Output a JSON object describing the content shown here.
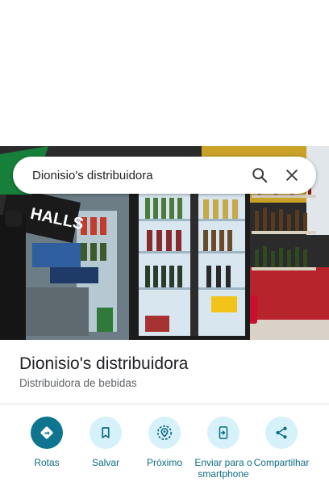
{
  "search": {
    "query": "Dionisio's distribuidora",
    "search_icon": "search-icon",
    "clear_icon": "close-icon"
  },
  "photo": {
    "ad_text": "HALLS"
  },
  "place": {
    "name": "Dionisio's distribuidora",
    "category": "Distribuidora de bebidas"
  },
  "actions": [
    {
      "label": "Rotas",
      "icon": "directions-icon"
    },
    {
      "label": "Salvar",
      "icon": "bookmark-icon"
    },
    {
      "label": "Próximo",
      "icon": "nearby-icon"
    },
    {
      "label": "Enviar para o smartphone",
      "icon": "send-to-phone-icon"
    },
    {
      "label": "Compartilhar",
      "icon": "share-icon"
    }
  ],
  "colors": {
    "accent": "#0e7490",
    "action_bg": "#d6f1fa",
    "action_label": "#0b6b82"
  }
}
